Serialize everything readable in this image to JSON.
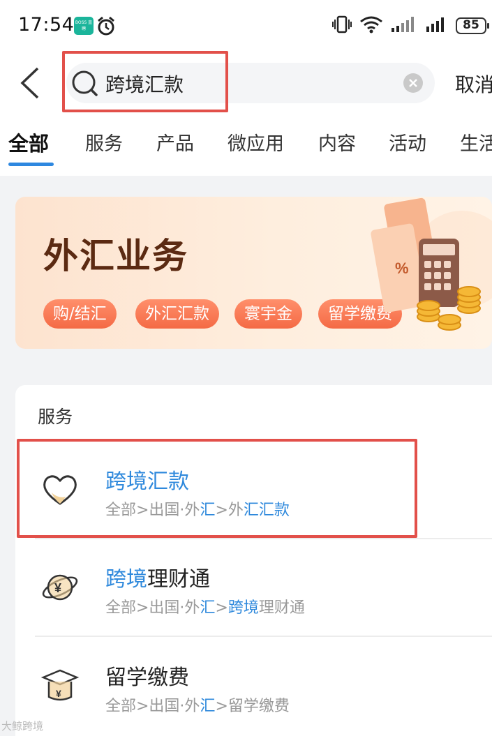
{
  "status_bar": {
    "time": "17:54",
    "boss_badge": "BOSS 直聘",
    "battery": "85"
  },
  "search": {
    "query": "跨境汇款",
    "cancel_label": "取消"
  },
  "tabs": [
    {
      "label": "全部",
      "active": true
    },
    {
      "label": "服务"
    },
    {
      "label": "产品"
    },
    {
      "label": "微应用"
    },
    {
      "label": "内容"
    },
    {
      "label": "活动"
    },
    {
      "label": "生活"
    }
  ],
  "banner": {
    "title": "外汇业务",
    "chips": [
      "购/结汇",
      "外汇汇款",
      "寰宇金",
      "留学缴费"
    ]
  },
  "results": {
    "section_title": "服务",
    "items": [
      {
        "icon": "heart-icon",
        "title_parts": [
          {
            "text": "跨境汇款",
            "hl": true
          }
        ],
        "path_parts": [
          {
            "text": "全部>出国·外",
            "hl": false
          },
          {
            "text": "汇",
            "hl": true
          },
          {
            "text": ">外",
            "hl": false
          },
          {
            "text": "汇汇款",
            "hl": true
          }
        ]
      },
      {
        "icon": "globe-yen-icon",
        "title_parts": [
          {
            "text": "跨境",
            "hl": true
          },
          {
            "text": "理财通",
            "hl": false
          }
        ],
        "path_parts": [
          {
            "text": "全部>出国·外",
            "hl": false
          },
          {
            "text": "汇",
            "hl": true
          },
          {
            "text": ">",
            "hl": false
          },
          {
            "text": "跨境",
            "hl": true
          },
          {
            "text": "理财通",
            "hl": false
          }
        ]
      },
      {
        "icon": "graduation-cap-icon",
        "title_parts": [
          {
            "text": "留学缴费",
            "hl": false
          }
        ],
        "path_parts": [
          {
            "text": "全部>出国·外",
            "hl": false
          },
          {
            "text": "汇",
            "hl": true
          },
          {
            "text": ">留学缴费",
            "hl": false
          }
        ]
      }
    ]
  },
  "watermark": "大鲸跨境",
  "colors": {
    "accent_blue": "#2f89dc",
    "highlight_red": "#e2504a",
    "chip_orange": "#f46a45",
    "banner_title": "#5b2a12"
  }
}
